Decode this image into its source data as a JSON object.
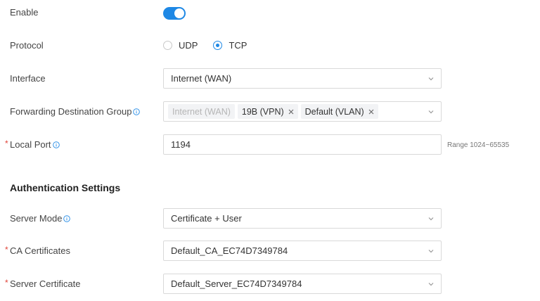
{
  "enable": {
    "label": "Enable",
    "on": true
  },
  "protocol": {
    "label": "Protocol",
    "options": [
      {
        "label": "UDP",
        "checked": false
      },
      {
        "label": "TCP",
        "checked": true
      }
    ]
  },
  "interface": {
    "label": "Interface",
    "value": "Internet (WAN)"
  },
  "forwarding": {
    "label": "Forwarding Destination Group",
    "tags": [
      {
        "label": "Internet (WAN)",
        "disabled": true
      },
      {
        "label": "19B (VPN)",
        "disabled": false
      },
      {
        "label": "Default (VLAN)",
        "disabled": false
      }
    ]
  },
  "local_port": {
    "required_mark": "*",
    "label": "Local Port",
    "value": "1194",
    "hint": "Range 1024~65535"
  },
  "auth": {
    "title": "Authentication Settings",
    "server_mode": {
      "label": "Server Mode",
      "value": "Certificate + User"
    },
    "ca_certificates": {
      "required_mark": "*",
      "label": "CA Certificates",
      "value": "Default_CA_EC74D7349784"
    },
    "server_certificate": {
      "required_mark": "*",
      "label": "Server Certificate",
      "value": "Default_Server_EC74D7349784"
    }
  },
  "colors": {
    "accent": "#1e88e5",
    "required": "#e0453a",
    "border": "#d9d9d9"
  },
  "icons": {
    "info": "info-circle-icon",
    "dropdown": "chevron-down-icon",
    "tag_remove": "close-icon"
  }
}
